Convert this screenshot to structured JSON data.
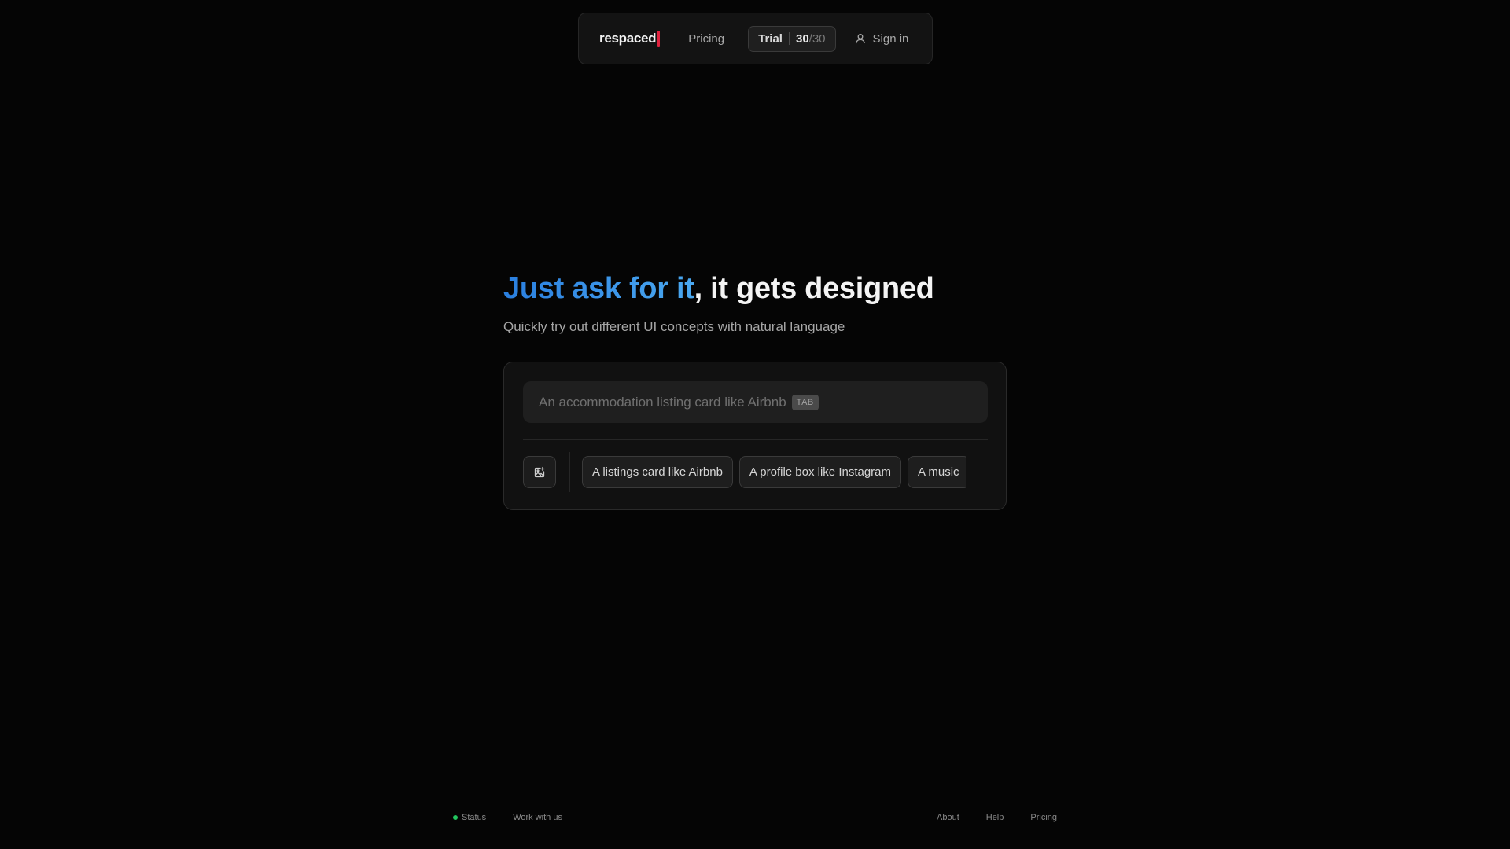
{
  "nav": {
    "logo": "respaced",
    "pricing": "Pricing",
    "trial_label": "Trial",
    "trial_used": "30",
    "trial_total": "/30",
    "signin": "Sign in"
  },
  "hero": {
    "title_accent": "Just ask for it",
    "title_rest": ", it gets designed",
    "subtitle": "Quickly try out different UI concepts with natural language"
  },
  "prompt": {
    "placeholder": "An accommodation listing card like Airbnb",
    "tab_hint": "TAB",
    "suggestions": [
      "A listings card like Airbnb",
      "A profile box like Instagram",
      "A music"
    ]
  },
  "footer": {
    "status": "Status",
    "work_with_us": "Work with us",
    "about": "About",
    "help": "Help",
    "pricing": "Pricing"
  },
  "colors": {
    "background": "#050505",
    "accent_start": "#2a7fe0",
    "accent_end": "#4aa8f0",
    "logo_cursor": "#e0223e",
    "status_ok": "#22c55e"
  },
  "icons": {
    "signin": "user-icon",
    "image_upload": "image-plus-icon"
  }
}
